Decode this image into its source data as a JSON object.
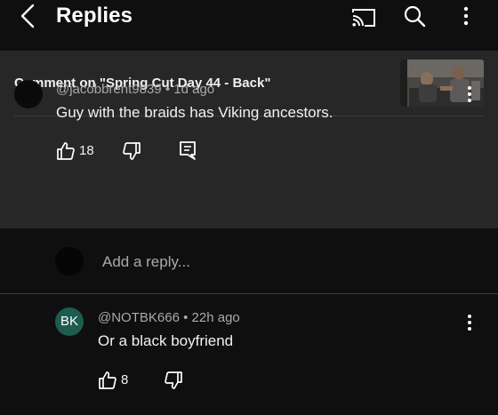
{
  "header": {
    "title": "Replies",
    "icons": [
      "chevron-left-icon",
      "cast-icon",
      "search-icon",
      "more-vertical-icon"
    ]
  },
  "context": {
    "label": "Comment on \"Spring Cut Day 44 - Back\""
  },
  "comment": {
    "author": "@jacobbrent9839",
    "age": "1d ago",
    "text": "Guy with the braids has Viking ancestors.",
    "likes": "18"
  },
  "reply_box": {
    "placeholder": "Add a reply..."
  },
  "replies": [
    {
      "avatar_initials": "BK",
      "author": "@NOTBK666",
      "age": "22h ago",
      "text": "Or a black boyfriend",
      "likes": "8"
    }
  ],
  "colors": {
    "background": "#0f0f0f",
    "panel": "#272727",
    "text_primary": "#f1f1f1",
    "text_secondary": "#aaaaaa",
    "avatar_bk": "#1d5c4f"
  }
}
